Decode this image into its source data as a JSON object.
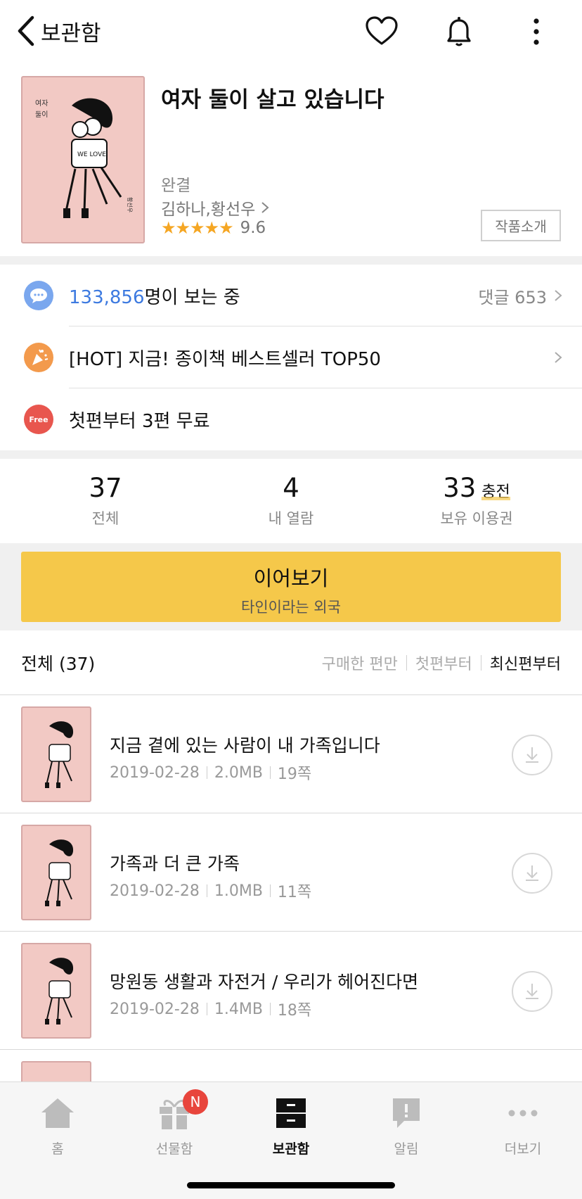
{
  "header": {
    "back_label": "보관함",
    "icons": [
      "heart-icon",
      "bell-icon",
      "more-vertical-icon"
    ]
  },
  "book": {
    "title": "여자 둘이 살고 있습니다",
    "status": "완결",
    "authors": "김하나,황선우",
    "stars": "★★★★★",
    "rating": "9.6",
    "intro_button": "작품소개"
  },
  "info": {
    "viewers_count": "133,856",
    "viewers_suffix": "명이 보는 중",
    "comments": "댓글 653",
    "promo": "[HOT] 지금! 종이책 베스트셀러 TOP50",
    "free_badge": "Free",
    "free_text": "첫편부터 3편 무료"
  },
  "stats": {
    "total_num": "37",
    "total_label": "전체",
    "read_num": "4",
    "read_label": "내 열람",
    "tickets_num": "33",
    "charge": "충전",
    "tickets_label": "보유 이용권"
  },
  "cta": {
    "main": "이어보기",
    "sub": "타인이라는 외국"
  },
  "list": {
    "heading": "전체 (37)",
    "sort_options": [
      "구매한 편만",
      "첫편부터",
      "최신편부터"
    ],
    "active_sort": "최신편부터"
  },
  "episodes": [
    {
      "title": "지금 곁에 있는 사람이 내 가족입니다",
      "date": "2019-02-28",
      "size": "2.0MB",
      "pages": "19쪽"
    },
    {
      "title": "가족과 더 큰 가족",
      "date": "2019-02-28",
      "size": "1.0MB",
      "pages": "11쪽"
    },
    {
      "title": "망원동 생활과 자전거 / 우리가 헤어진다면",
      "date": "2019-02-28",
      "size": "1.4MB",
      "pages": "18쪽"
    }
  ],
  "tabs": [
    {
      "label": "홈",
      "icon": "home-icon"
    },
    {
      "label": "선물함",
      "icon": "gift-icon",
      "badge": "N"
    },
    {
      "label": "보관함",
      "icon": "drawer-icon",
      "active": true
    },
    {
      "label": "알림",
      "icon": "notice-icon"
    },
    {
      "label": "더보기",
      "icon": "more-dots-icon"
    }
  ],
  "colors": {
    "accent_yellow": "#f5c84a",
    "link_blue": "#3d7ae0",
    "badge_red": "#e8453c",
    "star_orange": "#f5a623"
  }
}
